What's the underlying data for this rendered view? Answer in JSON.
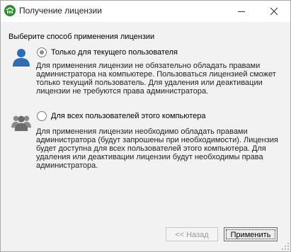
{
  "window": {
    "title": "Получение лицензии",
    "app_icon": "license-app-icon",
    "accent_color": "#2e8b2e"
  },
  "prompt": "Выберите способ применения лицензии",
  "options": [
    {
      "icon": "single-user-icon",
      "label": "Только для текущего пользователя",
      "selected": true,
      "description": "Для применения лицензии не обязательно обладать правами администратора на компьютере. Пользоваться лицензией сможет только текущий пользователь. Для удаления или деактивации лицензии не требуются права администратора."
    },
    {
      "icon": "user-group-icon",
      "label": "Для всех пользователей этого компьютера",
      "selected": false,
      "description": "Для применения лицензии необходимо обладать правами администратора (будут запрошены при необходимости). Лицензия будет доступна для всех пользователей этого компьютера. Для удаления или деактивации лицензии будут необходимы права администратора."
    }
  ],
  "buttons": {
    "back_label": "<< Назад",
    "back_enabled": false,
    "apply_label": "Применить"
  }
}
